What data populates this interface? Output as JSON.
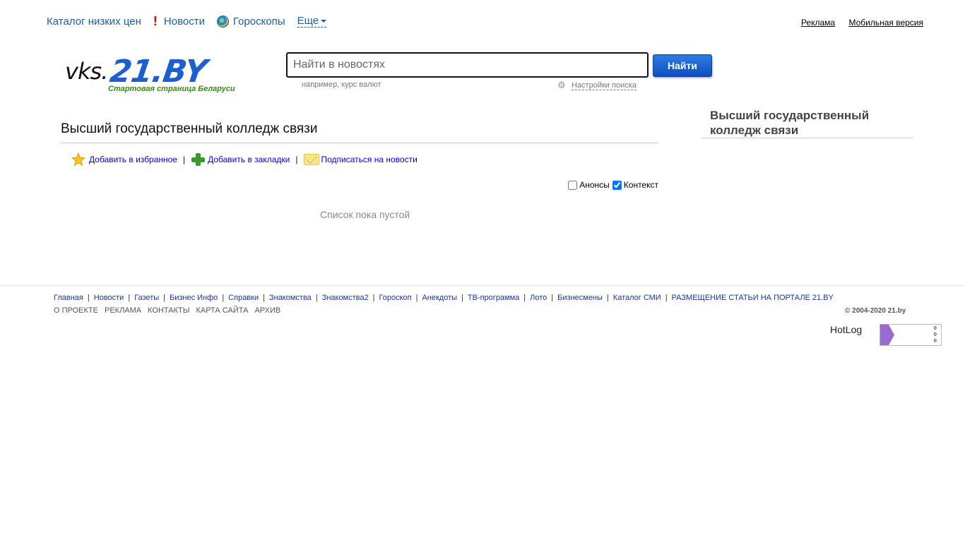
{
  "topnav": {
    "catalog": "Каталог низких цен",
    "news": "Новости",
    "horoscopes": "Гороскопы",
    "more": "Еще"
  },
  "toplinks": {
    "ads": "Реклама",
    "mobile": "Мобильная версия"
  },
  "logo": {
    "prefix": "vks.",
    "brand": "21.BY",
    "tagline": "Стартовая страница Беларуси"
  },
  "search": {
    "placeholder": "Найти в новостях",
    "button": "Найти",
    "hint": "например, курс валют",
    "settings": "Настройки поиска"
  },
  "main": {
    "title": "Высший государственный колледж связи",
    "actions": {
      "favorites": "Добавить в избранное",
      "bookmarks": "Добавить в закладки",
      "subscribe": "Подписаться на новости",
      "separator": "|"
    },
    "filters": {
      "announcements": "Анонсы",
      "announcements_checked": false,
      "context": "Контекст",
      "context_checked": true
    },
    "empty": "Список пока пустой"
  },
  "sidebar": {
    "title": "Высший государственный колледж связи"
  },
  "footer": {
    "links": [
      "Главная",
      "Новости",
      "Газеты",
      "Бизнес Инфо",
      "Справки",
      "Знакомства",
      "Знакомства2",
      "Гороскоп",
      "Анекдоты",
      "ТВ-программа",
      "Лото",
      "Бизнесмены",
      "Каталог СМИ",
      "РАЗМЕЩЕНИЕ СТАТЬИ НА ПОРТАЛЕ 21.BY"
    ],
    "secondary": [
      "О ПРОЕКТЕ",
      "РЕКЛАМА",
      "КОНТАКТЫ",
      "КАРТА САЙТА",
      "АРХИВ"
    ],
    "copyright": "© 2004-2020 21.by",
    "hotlog": "HotLog",
    "counter": [
      "0",
      "0",
      "0"
    ]
  },
  "colors": {
    "link": "#1a5ea8",
    "brand_blue": "#1e5fcf",
    "tagline_green": "#3a8a16",
    "footer_link": "#1733a8"
  }
}
